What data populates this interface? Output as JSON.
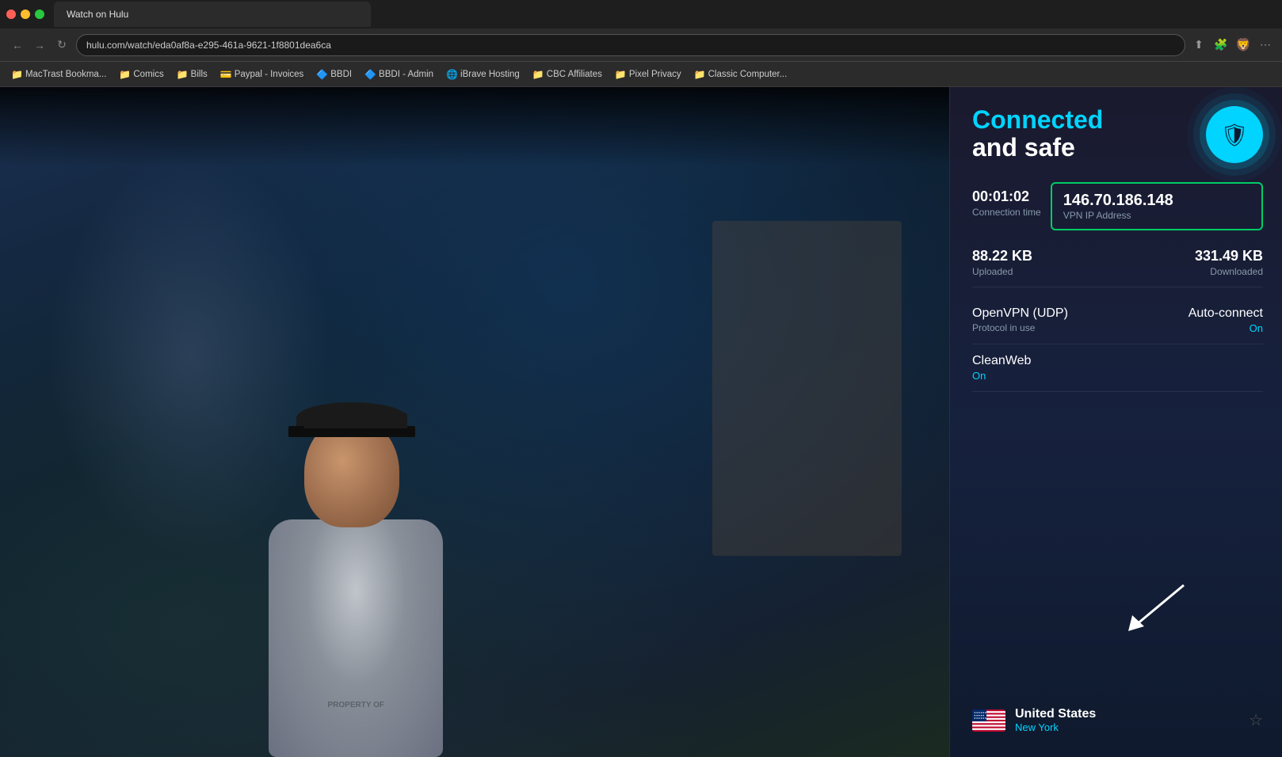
{
  "browser": {
    "url": "hulu.com/watch/eda0af8a-e295-461a-9621-1f8801dea6ca",
    "tab_title": "Watch on Hulu"
  },
  "bookmarks": [
    {
      "label": "MacTrast Bookma...",
      "icon": "📁"
    },
    {
      "label": "Comics",
      "icon": "📁"
    },
    {
      "label": "Bills",
      "icon": "📁"
    },
    {
      "label": "Paypal - Invoices",
      "icon": "💳"
    },
    {
      "label": "BBDI",
      "icon": "🔷"
    },
    {
      "label": "BBDI - Admin",
      "icon": "🔷"
    },
    {
      "label": "iBrave Hosting",
      "icon": "🌐"
    },
    {
      "label": "CBC Affiliates",
      "icon": "📁"
    },
    {
      "label": "Pixel Privacy",
      "icon": "📁"
    },
    {
      "label": "Classic Computer...",
      "icon": "📁"
    }
  ],
  "vpn": {
    "status_line1": "Connected",
    "status_line2": "and safe",
    "connection_time": "00:01:02",
    "connection_time_label": "Connection time",
    "ip_address": "146.70.186.148",
    "ip_label": "VPN IP Address",
    "uploaded": "88.22 KB",
    "uploaded_label": "Uploaded",
    "downloaded": "331.49 KB",
    "downloaded_label": "Downloaded",
    "protocol": "OpenVPN (UDP)",
    "protocol_label": "Protocol in use",
    "auto_connect_label": "Auto-connect",
    "auto_connect_value": "On",
    "cleanweb_label": "CleanWeb",
    "cleanweb_value": "On",
    "location_country": "United States",
    "location_city": "New York",
    "shield_icon": "🛡"
  },
  "colors": {
    "accent_cyan": "#00d4ff",
    "accent_green": "#00cc66",
    "panel_bg": "#1a1a2e",
    "text_primary": "#ffffff",
    "text_secondary": "#8899aa",
    "text_on": "#00d4ff"
  }
}
